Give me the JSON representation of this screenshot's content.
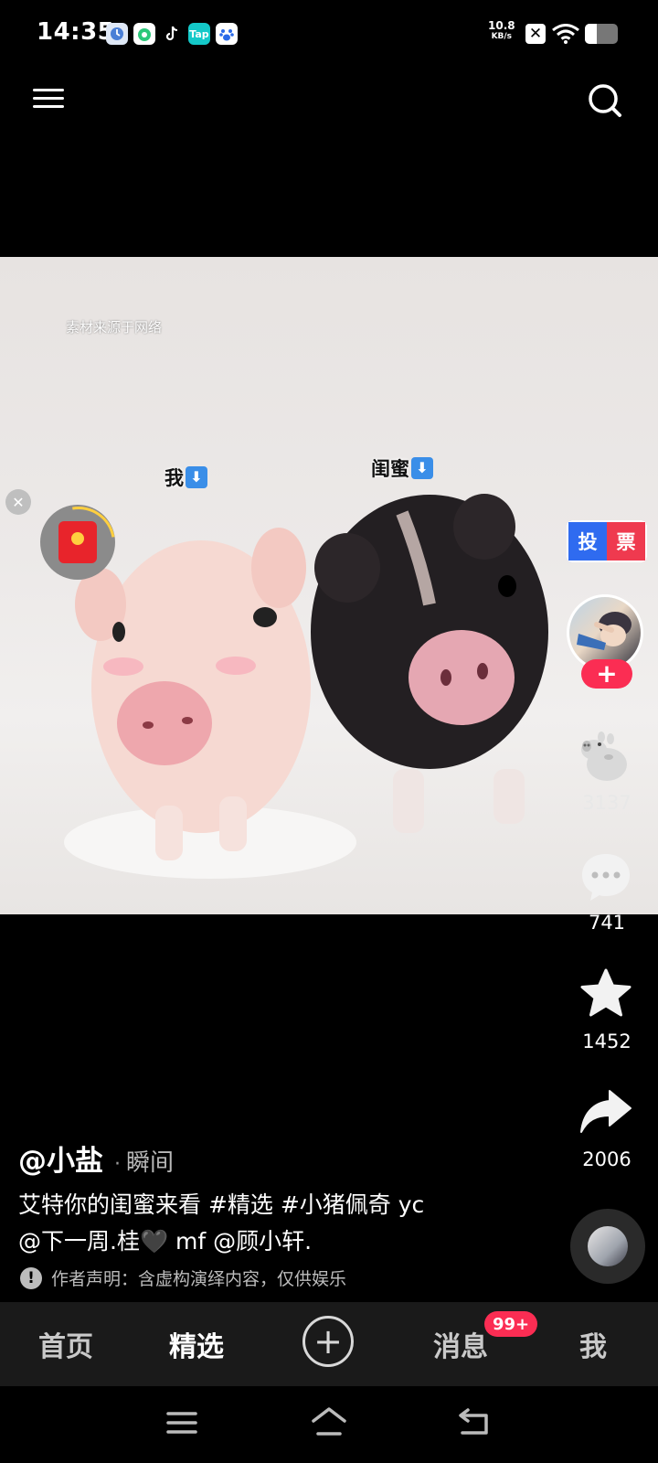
{
  "status_bar": {
    "time": "14:35",
    "app_icons": [
      "clock-app-icon",
      "green-app-icon",
      "tiktok-app-icon",
      "taptap-app-icon",
      "baidu-app-icon"
    ],
    "taptap_label": "Tap",
    "net_speed": "10.8",
    "net_unit": "KB/s",
    "battery_level": 0.35
  },
  "video": {
    "watermark": "素材来源于网络",
    "tag_me": "我",
    "tag_bff": "闺蜜",
    "tag_arrow": "⬇"
  },
  "float": {
    "close_glyph": "✕"
  },
  "rail": {
    "vote_left": "投",
    "vote_right": "票",
    "follow_glyph": "+",
    "likes": "3137",
    "comments": "741",
    "favorites": "1452",
    "shares": "2006"
  },
  "post": {
    "author": "@小盐",
    "separator": "·",
    "time": "瞬间",
    "caption_line1": "艾特你的闺蜜来看 #精选 #小猪佩奇 yc",
    "caption_line2": "@下一周.桂🖤 mf @顾小轩.",
    "disclaimer_icon": "!",
    "disclaimer": "作者声明：含虚构演绎内容，仅供娱乐"
  },
  "tabs": {
    "home": "首页",
    "featured": "精选",
    "add": "+",
    "messages": "消息",
    "messages_badge": "99+",
    "me": "我"
  },
  "colors": {
    "accent": "#fb2d53",
    "tab_bar": "#1a1a1a",
    "vote_blue": "#2f6bf0",
    "vote_red": "#ef3a4f"
  }
}
